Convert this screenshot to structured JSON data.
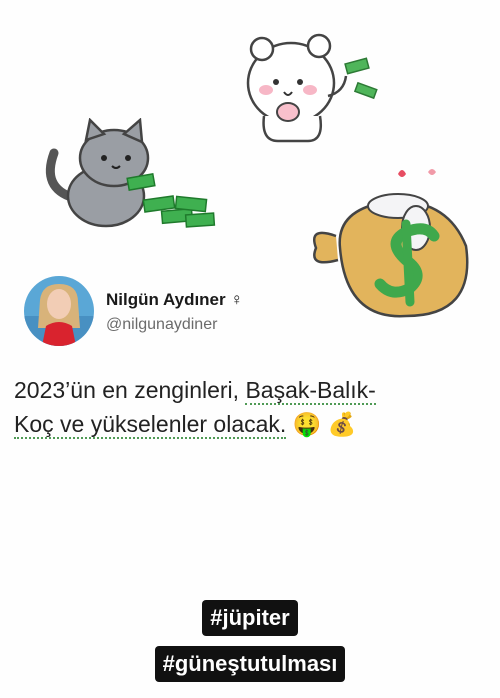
{
  "tweet": {
    "author_name": "Nilgün Aydıner",
    "gender_symbol": "♀",
    "handle": "@nilgunaydiner",
    "text_line1_a": "2023’ün en zenginleri, ",
    "text_line1_b": "Başak-Balık-",
    "text_line2_a": "Koç ve yükselenler olacak.",
    "text_emoji1": "🤑",
    "text_emoji2": "💰"
  },
  "hashtags": [
    "#jüpiter",
    "#güneştutulması"
  ],
  "stickers": [
    {
      "name": "bear-money-icon",
      "description": "cartoon bear with cash"
    },
    {
      "name": "cat-money-icon",
      "description": "cartoon cat with cash"
    },
    {
      "name": "money-bag-icon",
      "description": "money bag with dollar sign"
    }
  ],
  "colors": {
    "money_green": "#3da84a",
    "bag": "#e2b45c",
    "hashtag_bg": "#111111",
    "hashtag_text": "#ffffff"
  }
}
